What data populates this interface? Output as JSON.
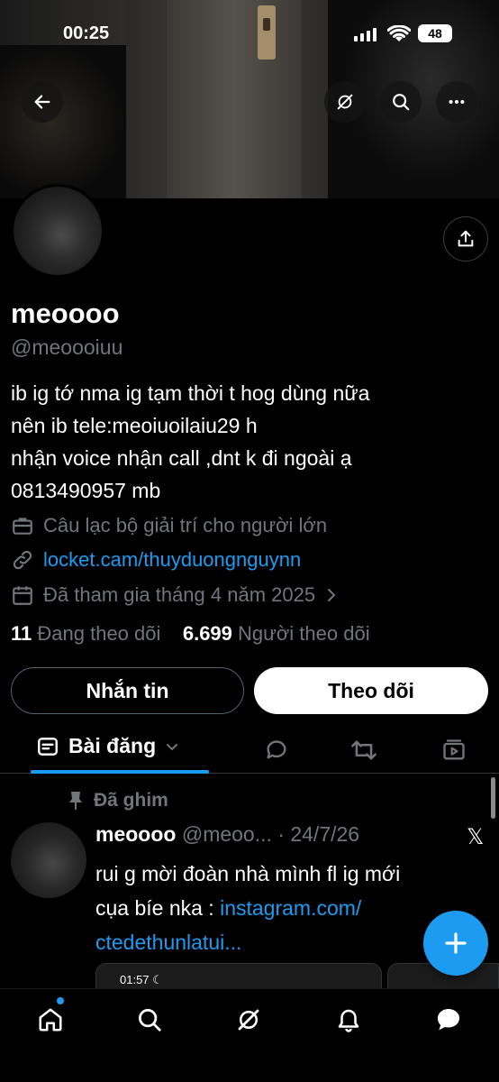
{
  "status_bar": {
    "time": "00:25",
    "battery": "48"
  },
  "profile": {
    "name": "meoooo",
    "handle": "@meoooiuu",
    "bio_lines": [
      "ib ig tớ nma ig tạm thời t hog dùng nữa",
      "nên ib tele:meoiuoilaiu29 h",
      "nhận voice nhận call ,dnt k đi ngoài ạ",
      "0813490957 mb"
    ],
    "category": "Câu lạc bộ giải trí cho người lớn",
    "link": "locket.cam/thuyduongnguynn",
    "joined": "Đã tham gia tháng 4 năm 2025",
    "following_count": "11",
    "following_label": "Đang theo dõi",
    "followers_count": "6.699",
    "followers_label": "Người theo dõi"
  },
  "actions": {
    "message_label": "Nhắn tin",
    "follow_label": "Theo dõi"
  },
  "tabs": {
    "active_label": "Bài đăng"
  },
  "pinned_post": {
    "pinned_label": "Đã ghim",
    "author_name": "meoooo",
    "author_handle": "@meoo...",
    "date": "· 24/7/26",
    "text_1": "rui g mời đoàn nhà mình fl ig mới",
    "text_2": "cụa bíe nka : ",
    "link_1": "instagram.com/",
    "link_2": "ctedethunlatui...",
    "thumb_time": "01:57 ☾"
  },
  "icons": {
    "back": "back-arrow-icon",
    "grok": "grok-icon",
    "search": "search-icon",
    "more": "more-icon",
    "share": "share-icon"
  },
  "colors": {
    "accent": "#1d9bf0",
    "background": "#000000",
    "muted": "#71767b"
  }
}
